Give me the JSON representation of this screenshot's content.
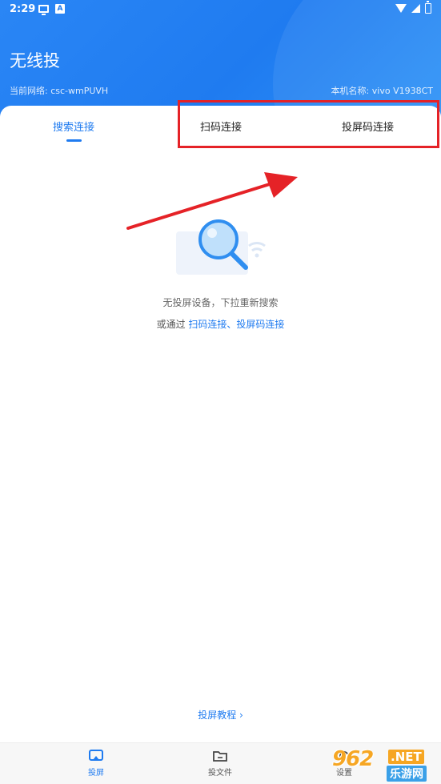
{
  "status_bar": {
    "time": "2:29",
    "a_icon_text": "A"
  },
  "header": {
    "title": "无线投",
    "network_label": "当前网络: csc-wmPUVH",
    "device_label": "本机名称: vivo V1938CT"
  },
  "tabs": [
    {
      "label": "搜索连接",
      "active": true
    },
    {
      "label": "扫码连接",
      "active": false
    },
    {
      "label": "投屏码连接",
      "active": false
    }
  ],
  "empty_state": {
    "message": "无投屏设备，下拉重新搜索",
    "alt_prefix": "或通过 ",
    "alt_link": "扫码连接、投屏码连接"
  },
  "tutorial_link": "投屏教程 ›",
  "bottom_nav": [
    {
      "label": "投屏",
      "icon": "cast-screen-icon",
      "active": true
    },
    {
      "label": "投文件",
      "icon": "folder-icon",
      "active": false
    },
    {
      "label": "设置",
      "icon": "settings-icon",
      "active": false
    }
  ],
  "watermark": {
    "badge": "962",
    "net": ".NET",
    "site": "乐游网"
  },
  "colors": {
    "primary": "#1f7bf0",
    "annotation_red": "#e52227"
  }
}
